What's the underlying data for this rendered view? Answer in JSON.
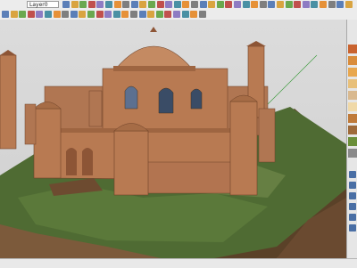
{
  "toolbar": {
    "layer_label": "",
    "layer_value": "Layer0",
    "row1_icons": [
      "select-icon",
      "eraser-icon",
      "paint-bucket-icon",
      "line-icon",
      "arc-icon",
      "rectangle-icon",
      "circle-icon",
      "push-pull-icon",
      "move-icon",
      "rotate-icon",
      "scale-icon",
      "offset-icon",
      "tape-measure-icon",
      "text-icon",
      "axes-icon",
      "orbit-icon",
      "pan-icon",
      "zoom-icon",
      "zoom-extents-icon",
      "previous-view-icon",
      "next-view-icon",
      "iso-view-icon",
      "top-view-icon",
      "front-view-icon",
      "right-view-icon",
      "back-view-icon",
      "left-view-icon",
      "xray-icon",
      "wireframe-icon",
      "hidden-line-icon",
      "shaded-icon",
      "textured-icon",
      "monochrome-icon",
      "warehouse-icon",
      "extension-icon",
      "ruby-icon",
      "help-icon"
    ],
    "row2_icons": [
      "cube-icon",
      "sphere-icon",
      "camera-icon",
      "section-plane-icon",
      "section-display-icon",
      "sandbox-icon",
      "shadow-icon",
      "fog-icon",
      "style-icon",
      "component-icon",
      "material-icon",
      "scene-icon",
      "layer-icon",
      "outliner-icon",
      "entity-info-icon",
      "soften-icon",
      "photo-match-icon",
      "dimension-icon",
      "protractor-icon",
      "follow-me-icon",
      "intersect-icon",
      "solid-tools-icon",
      "google-earth-icon",
      "settings-icon"
    ]
  },
  "tray": {
    "material_swatches": [
      "#c9632f",
      "#d98c3b",
      "#e8a74e",
      "#e8c07a",
      "#d9b98f",
      "#f0d9a8",
      "#bf7a3a",
      "#9e6a3a",
      "#6b8f3a",
      "#8a8a8a"
    ],
    "tools": [
      "orbit-icon",
      "pan-icon",
      "zoom-icon",
      "walk-icon",
      "look-around-icon",
      "position-camera-icon"
    ]
  },
  "colors": {
    "brick": "#b87a52",
    "brick_dark": "#8d5536",
    "dome": "#c48a62",
    "window": "#3a4c66",
    "grass": "#4f6b33",
    "soil": "#7c5a3b",
    "sky": "#d3d3d3"
  }
}
